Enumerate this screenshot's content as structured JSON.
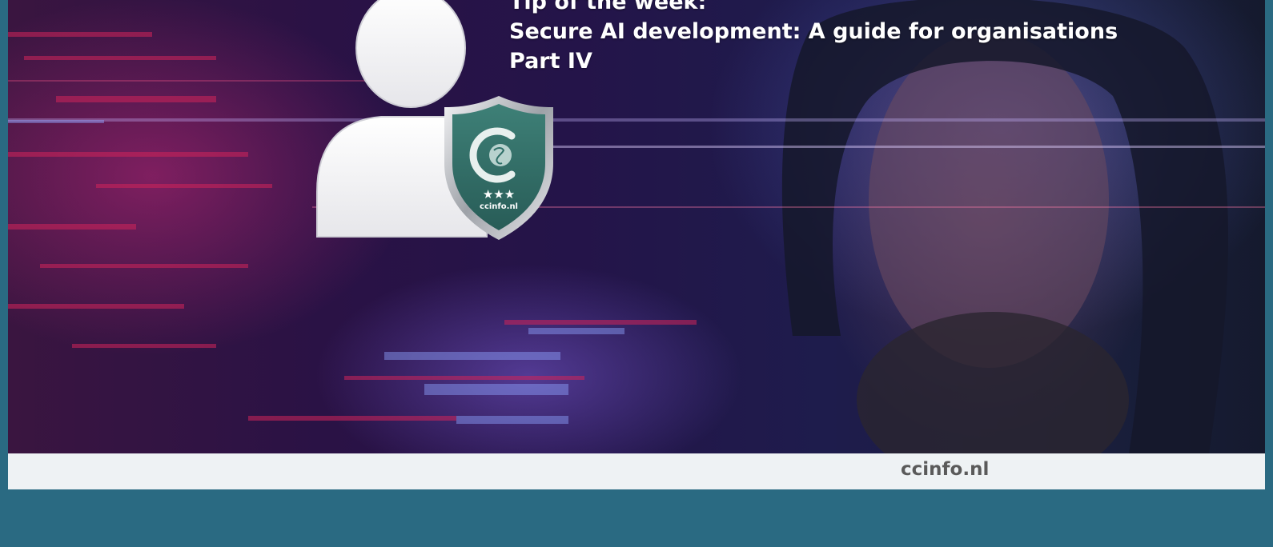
{
  "banner": {
    "title_lines": [
      "Tip of the week:",
      "Secure AI development: A guide for organisations",
      "Part IV"
    ]
  },
  "badge": {
    "logo_letter": "C",
    "stars": "★★★",
    "site": "ccinfo.nl",
    "icon": "globe-icon"
  },
  "footer": {
    "domain": "ccinfo.nl"
  },
  "colors": {
    "page_background": "#2a6a82",
    "footer_background": "#eef2f4",
    "shield_green": "#2f6f68",
    "title_text": "#ffffff",
    "footer_text": "#5a5a5a"
  }
}
